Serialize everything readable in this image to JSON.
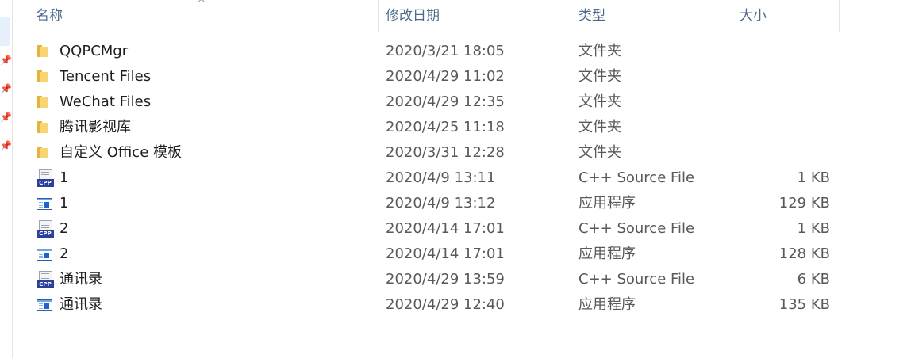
{
  "header": {
    "name": "名称",
    "date": "修改日期",
    "type": "类型",
    "size": "大小",
    "sort_indicator": "^"
  },
  "files": [
    {
      "name": "QQPCMgr",
      "date": "2020/3/21 18:05",
      "type": "文件夹",
      "size": "",
      "icon": "folder-icon"
    },
    {
      "name": "Tencent Files",
      "date": "2020/4/29 11:02",
      "type": "文件夹",
      "size": "",
      "icon": "folder-icon"
    },
    {
      "name": "WeChat Files",
      "date": "2020/4/29 12:35",
      "type": "文件夹",
      "size": "",
      "icon": "folder-icon"
    },
    {
      "name": "腾讯影视库",
      "date": "2020/4/25 11:18",
      "type": "文件夹",
      "size": "",
      "icon": "folder-icon"
    },
    {
      "name": "自定义 Office 模板",
      "date": "2020/3/31 12:28",
      "type": "文件夹",
      "size": "",
      "icon": "folder-icon"
    },
    {
      "name": "1",
      "date": "2020/4/9 13:11",
      "type": "C++ Source File",
      "size": "1 KB",
      "icon": "cpp-file-icon"
    },
    {
      "name": "1",
      "date": "2020/4/9 13:12",
      "type": "应用程序",
      "size": "129 KB",
      "icon": "exe-file-icon"
    },
    {
      "name": "2",
      "date": "2020/4/14 17:01",
      "type": "C++ Source File",
      "size": "1 KB",
      "icon": "cpp-file-icon"
    },
    {
      "name": "2",
      "date": "2020/4/14 17:01",
      "type": "应用程序",
      "size": "128 KB",
      "icon": "exe-file-icon"
    },
    {
      "name": "通讯录",
      "date": "2020/4/29 13:59",
      "type": "C++ Source File",
      "size": "6 KB",
      "icon": "cpp-file-icon"
    },
    {
      "name": "通讯录",
      "date": "2020/4/29 12:40",
      "type": "应用程序",
      "size": "135 KB",
      "icon": "exe-file-icon"
    }
  ],
  "icon_text": {
    "cpp_badge": "CPP"
  },
  "colors": {
    "header_text": "#4d6a8e",
    "selection": "#e5f0fb",
    "folder": "#f8d574"
  }
}
